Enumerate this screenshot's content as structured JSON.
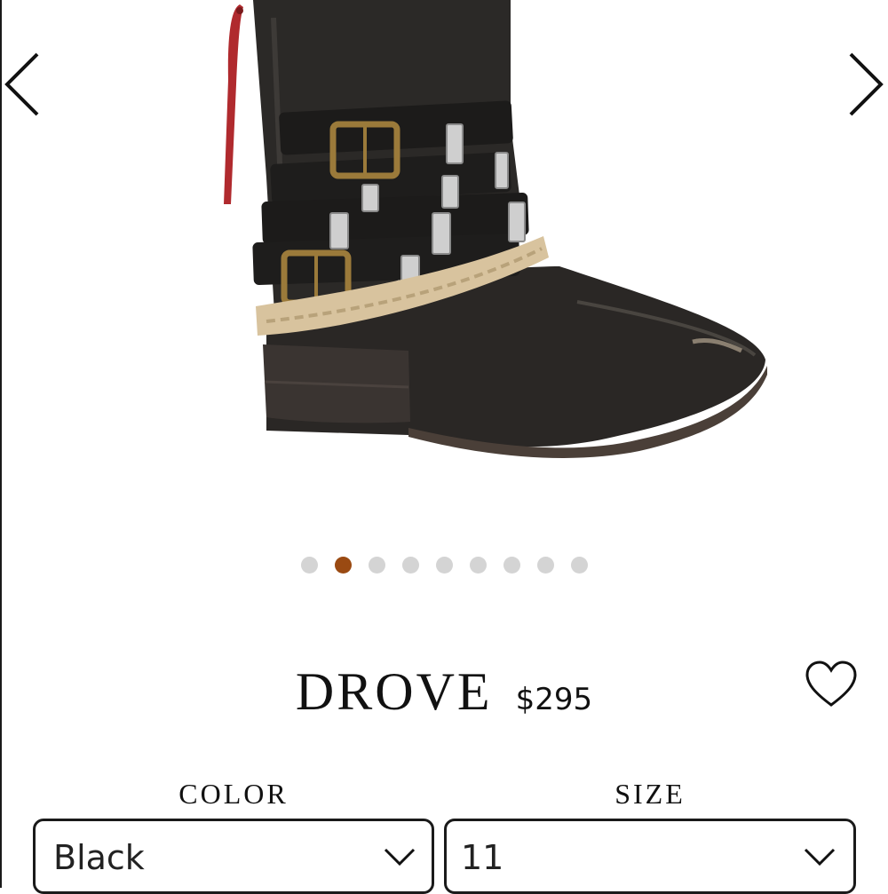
{
  "gallery": {
    "product_image": "black-leather-western-boot",
    "prev_icon": "chevron-left-icon",
    "next_icon": "chevron-right-icon",
    "image_count": 9,
    "active_index": 1,
    "active_dot_color": "#9a4a12"
  },
  "product": {
    "name": "DROVE",
    "price": "$295",
    "favorite_icon": "heart-icon"
  },
  "color_select": {
    "label": "COLOR",
    "value": "Black"
  },
  "size_select": {
    "label": "SIZE",
    "value": "11"
  }
}
